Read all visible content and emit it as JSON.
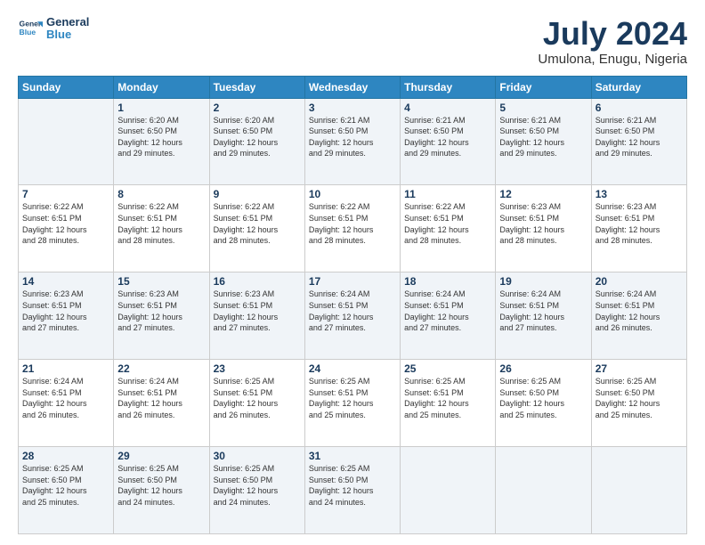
{
  "logo": {
    "line1": "General",
    "line2": "Blue"
  },
  "title": "July 2024",
  "subtitle": "Umulona, Enugu, Nigeria",
  "header_days": [
    "Sunday",
    "Monday",
    "Tuesday",
    "Wednesday",
    "Thursday",
    "Friday",
    "Saturday"
  ],
  "weeks": [
    {
      "days": [
        {
          "num": "",
          "sunrise": "",
          "sunset": "",
          "daylight": ""
        },
        {
          "num": "1",
          "sunrise": "Sunrise: 6:20 AM",
          "sunset": "Sunset: 6:50 PM",
          "daylight": "Daylight: 12 hours and 29 minutes."
        },
        {
          "num": "2",
          "sunrise": "Sunrise: 6:20 AM",
          "sunset": "Sunset: 6:50 PM",
          "daylight": "Daylight: 12 hours and 29 minutes."
        },
        {
          "num": "3",
          "sunrise": "Sunrise: 6:21 AM",
          "sunset": "Sunset: 6:50 PM",
          "daylight": "Daylight: 12 hours and 29 minutes."
        },
        {
          "num": "4",
          "sunrise": "Sunrise: 6:21 AM",
          "sunset": "Sunset: 6:50 PM",
          "daylight": "Daylight: 12 hours and 29 minutes."
        },
        {
          "num": "5",
          "sunrise": "Sunrise: 6:21 AM",
          "sunset": "Sunset: 6:50 PM",
          "daylight": "Daylight: 12 hours and 29 minutes."
        },
        {
          "num": "6",
          "sunrise": "Sunrise: 6:21 AM",
          "sunset": "Sunset: 6:50 PM",
          "daylight": "Daylight: 12 hours and 29 minutes."
        }
      ]
    },
    {
      "days": [
        {
          "num": "7",
          "sunrise": "Sunrise: 6:22 AM",
          "sunset": "Sunset: 6:51 PM",
          "daylight": "Daylight: 12 hours and 28 minutes."
        },
        {
          "num": "8",
          "sunrise": "Sunrise: 6:22 AM",
          "sunset": "Sunset: 6:51 PM",
          "daylight": "Daylight: 12 hours and 28 minutes."
        },
        {
          "num": "9",
          "sunrise": "Sunrise: 6:22 AM",
          "sunset": "Sunset: 6:51 PM",
          "daylight": "Daylight: 12 hours and 28 minutes."
        },
        {
          "num": "10",
          "sunrise": "Sunrise: 6:22 AM",
          "sunset": "Sunset: 6:51 PM",
          "daylight": "Daylight: 12 hours and 28 minutes."
        },
        {
          "num": "11",
          "sunrise": "Sunrise: 6:22 AM",
          "sunset": "Sunset: 6:51 PM",
          "daylight": "Daylight: 12 hours and 28 minutes."
        },
        {
          "num": "12",
          "sunrise": "Sunrise: 6:23 AM",
          "sunset": "Sunset: 6:51 PM",
          "daylight": "Daylight: 12 hours and 28 minutes."
        },
        {
          "num": "13",
          "sunrise": "Sunrise: 6:23 AM",
          "sunset": "Sunset: 6:51 PM",
          "daylight": "Daylight: 12 hours and 28 minutes."
        }
      ]
    },
    {
      "days": [
        {
          "num": "14",
          "sunrise": "Sunrise: 6:23 AM",
          "sunset": "Sunset: 6:51 PM",
          "daylight": "Daylight: 12 hours and 27 minutes."
        },
        {
          "num": "15",
          "sunrise": "Sunrise: 6:23 AM",
          "sunset": "Sunset: 6:51 PM",
          "daylight": "Daylight: 12 hours and 27 minutes."
        },
        {
          "num": "16",
          "sunrise": "Sunrise: 6:23 AM",
          "sunset": "Sunset: 6:51 PM",
          "daylight": "Daylight: 12 hours and 27 minutes."
        },
        {
          "num": "17",
          "sunrise": "Sunrise: 6:24 AM",
          "sunset": "Sunset: 6:51 PM",
          "daylight": "Daylight: 12 hours and 27 minutes."
        },
        {
          "num": "18",
          "sunrise": "Sunrise: 6:24 AM",
          "sunset": "Sunset: 6:51 PM",
          "daylight": "Daylight: 12 hours and 27 minutes."
        },
        {
          "num": "19",
          "sunrise": "Sunrise: 6:24 AM",
          "sunset": "Sunset: 6:51 PM",
          "daylight": "Daylight: 12 hours and 27 minutes."
        },
        {
          "num": "20",
          "sunrise": "Sunrise: 6:24 AM",
          "sunset": "Sunset: 6:51 PM",
          "daylight": "Daylight: 12 hours and 26 minutes."
        }
      ]
    },
    {
      "days": [
        {
          "num": "21",
          "sunrise": "Sunrise: 6:24 AM",
          "sunset": "Sunset: 6:51 PM",
          "daylight": "Daylight: 12 hours and 26 minutes."
        },
        {
          "num": "22",
          "sunrise": "Sunrise: 6:24 AM",
          "sunset": "Sunset: 6:51 PM",
          "daylight": "Daylight: 12 hours and 26 minutes."
        },
        {
          "num": "23",
          "sunrise": "Sunrise: 6:25 AM",
          "sunset": "Sunset: 6:51 PM",
          "daylight": "Daylight: 12 hours and 26 minutes."
        },
        {
          "num": "24",
          "sunrise": "Sunrise: 6:25 AM",
          "sunset": "Sunset: 6:51 PM",
          "daylight": "Daylight: 12 hours and 25 minutes."
        },
        {
          "num": "25",
          "sunrise": "Sunrise: 6:25 AM",
          "sunset": "Sunset: 6:51 PM",
          "daylight": "Daylight: 12 hours and 25 minutes."
        },
        {
          "num": "26",
          "sunrise": "Sunrise: 6:25 AM",
          "sunset": "Sunset: 6:50 PM",
          "daylight": "Daylight: 12 hours and 25 minutes."
        },
        {
          "num": "27",
          "sunrise": "Sunrise: 6:25 AM",
          "sunset": "Sunset: 6:50 PM",
          "daylight": "Daylight: 12 hours and 25 minutes."
        }
      ]
    },
    {
      "days": [
        {
          "num": "28",
          "sunrise": "Sunrise: 6:25 AM",
          "sunset": "Sunset: 6:50 PM",
          "daylight": "Daylight: 12 hours and 25 minutes."
        },
        {
          "num": "29",
          "sunrise": "Sunrise: 6:25 AM",
          "sunset": "Sunset: 6:50 PM",
          "daylight": "Daylight: 12 hours and 24 minutes."
        },
        {
          "num": "30",
          "sunrise": "Sunrise: 6:25 AM",
          "sunset": "Sunset: 6:50 PM",
          "daylight": "Daylight: 12 hours and 24 minutes."
        },
        {
          "num": "31",
          "sunrise": "Sunrise: 6:25 AM",
          "sunset": "Sunset: 6:50 PM",
          "daylight": "Daylight: 12 hours and 24 minutes."
        },
        {
          "num": "",
          "sunrise": "",
          "sunset": "",
          "daylight": ""
        },
        {
          "num": "",
          "sunrise": "",
          "sunset": "",
          "daylight": ""
        },
        {
          "num": "",
          "sunrise": "",
          "sunset": "",
          "daylight": ""
        }
      ]
    }
  ]
}
